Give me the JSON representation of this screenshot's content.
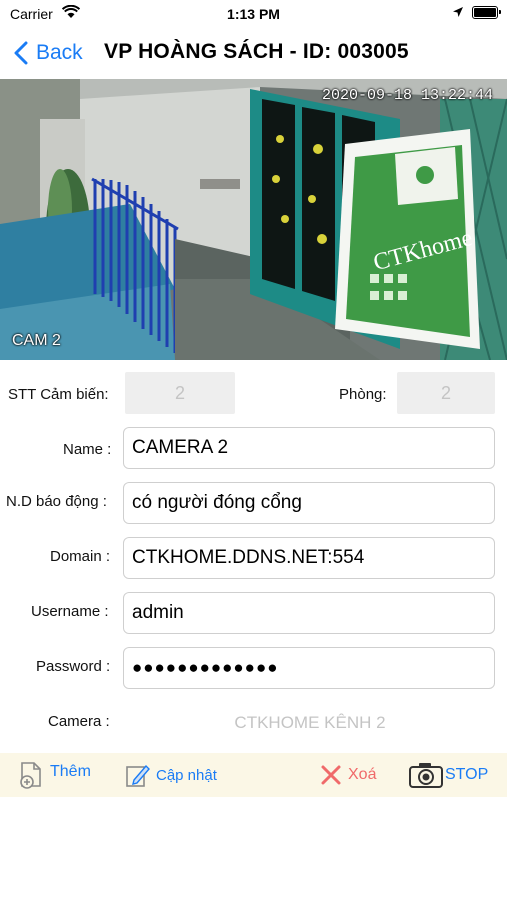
{
  "status_bar": {
    "carrier": "Carrier",
    "time": "1:13 PM"
  },
  "nav": {
    "back_label": "Back",
    "title": "VP HOÀNG SÁCH - ID: 003005"
  },
  "camera_feed": {
    "timestamp": "2020-09-18 13:22:44",
    "camera_label": "CAM 2"
  },
  "form": {
    "sensor_no_label": "STT Cảm biến:",
    "sensor_no_value": "2",
    "room_label": "Phòng:",
    "room_value": "2",
    "name_label": "Name :",
    "name_value": "CAMERA 2",
    "alarm_label": "N.D báo động :",
    "alarm_value": "có người đóng cổng",
    "domain_label": "Domain :",
    "domain_value": "CTKHOME.DDNS.NET:554",
    "username_label": "Username :",
    "username_value": "admin",
    "password_label": "Password :",
    "password_value": "●●●●●●●●●●●●●",
    "camera_label": "Camera :",
    "camera_value": "CTKHOME KÊNH 2"
  },
  "toolbar": {
    "add_label": "Thêm",
    "update_label": "Cập nhật",
    "delete_label": "Xoá",
    "stop_label": "STOP"
  },
  "colors": {
    "accent": "#1a7cf5",
    "delete": "#f06a6a",
    "toolbar_bg": "#fbf7e6",
    "input_border": "#cfcfcf",
    "disabled_box": "#eeeeee"
  },
  "icons": {
    "back": "chevron-left-icon",
    "add": "document-plus-icon",
    "update": "pencil-note-icon",
    "delete": "x-icon",
    "stop": "camera-icon"
  }
}
